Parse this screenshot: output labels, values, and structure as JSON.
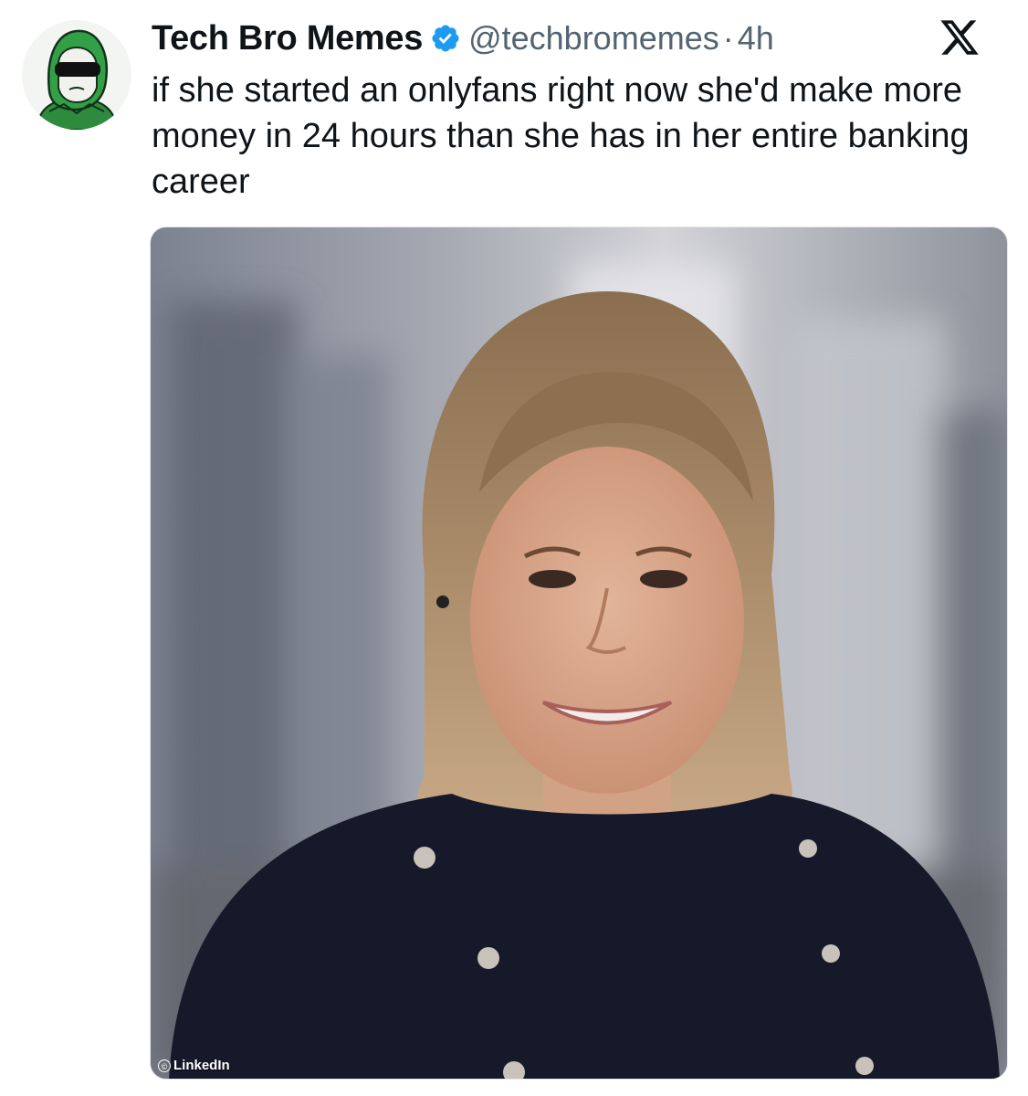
{
  "tweet": {
    "display_name": "Tech Bro Memes",
    "handle": "@techbromemes",
    "separator": "·",
    "timestamp": "4h",
    "text": "if she started an onlyfans right now she'd make more money in 24 hours than she has in her entire banking career",
    "verified": true,
    "verified_color": "#1d9bf0"
  },
  "media": {
    "credit_label": "LinkedIn",
    "credit_icon": "©"
  },
  "icons": {
    "avatar": "hooded-avatar-icon",
    "verified": "verified-badge-icon",
    "platform": "x-logo-icon"
  }
}
